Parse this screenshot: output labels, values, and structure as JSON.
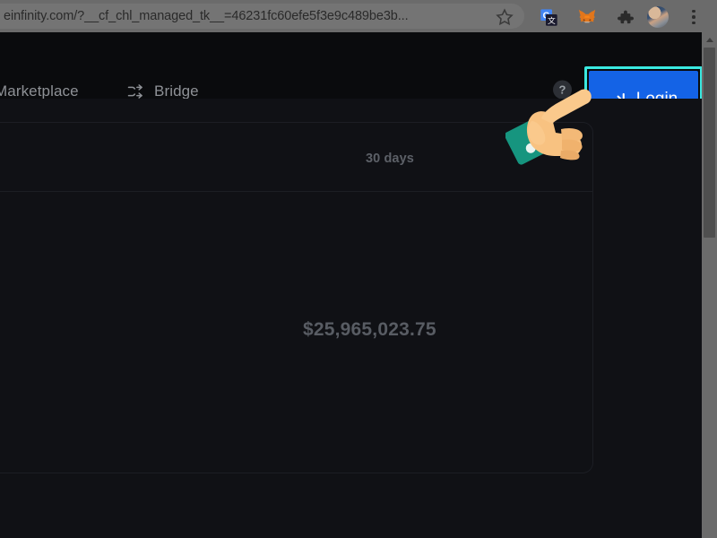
{
  "browser": {
    "url": "einfinity.com/?__cf_chl_managed_tk__=46231fc60efe5f3e9c489be3b...",
    "icons": {
      "bookmark": "star-icon",
      "translate": "google-translate-icon",
      "wallet": "metamask-fox-icon",
      "extensions": "puzzle-piece-icon",
      "profile": "profile-avatar",
      "menu": "three-dot-menu-icon"
    }
  },
  "navbar": {
    "marketplace_label": "Marketplace",
    "bridge_label": "Bridge",
    "bridge_icon": "shuffle-arrows-icon",
    "help_icon_glyph": "?",
    "login_label": "Login",
    "login_icon": "sign-in-arrow-icon",
    "login_bg_color": "#1463e6",
    "highlight_color": "#3ae9e0"
  },
  "content": {
    "range_label": "30 days",
    "total_value": "$25,965,023.75",
    "card_border_color": "#1c1e24",
    "background_color": "#101115"
  },
  "annotation": {
    "cursor": "pointing-hand-cursor",
    "skin_color": "#f5bf7e",
    "sleeve_color": "#16957f"
  },
  "scrollbar": {
    "track_color": "#6b6b6b",
    "thumb_color": "#4f4f4f",
    "up_arrow_icon": "scroll-up-arrow-icon"
  }
}
